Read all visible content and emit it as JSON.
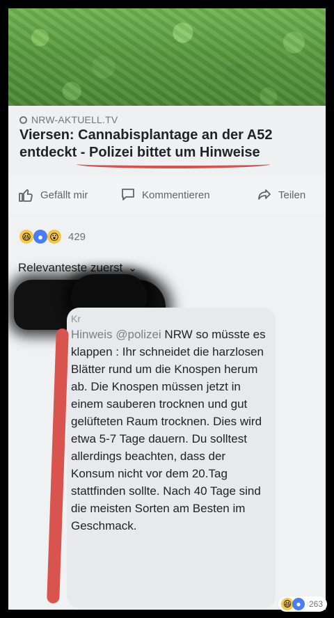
{
  "article": {
    "source": "NRW-AKTUELL.TV",
    "headline": "Viersen: Cannabisplantage an der A52 entdeckt - Polizei bittet um Hinweise"
  },
  "actions": {
    "like": "Gefällt mir",
    "comment": "Kommentieren",
    "share": "Teilen"
  },
  "reactions": {
    "count": "429",
    "icons": [
      "haha-icon",
      "care-icon",
      "wow-icon"
    ]
  },
  "sort": {
    "label": "Relevanteste zuerst"
  },
  "comment": {
    "author": "Kr",
    "mention": "Hinweis @polizei",
    "text": " NRW so müsste es klappen : Ihr schneidet die harzlosen Blätter rund um die Knospen herum ab. Die Knospen müssen jetzt in einem sauberen trocknen und gut gelüfteten Raum trocknen. Dies wird etwa 5-7 Tage dauern. Du solltest allerdings beachten, dass der Konsum nicht vor dem 20.Tag stattfinden sollte. Nach 40 Tage sind die meisten Sorten am Besten im Geschmack.",
    "reaction_count": "263"
  }
}
